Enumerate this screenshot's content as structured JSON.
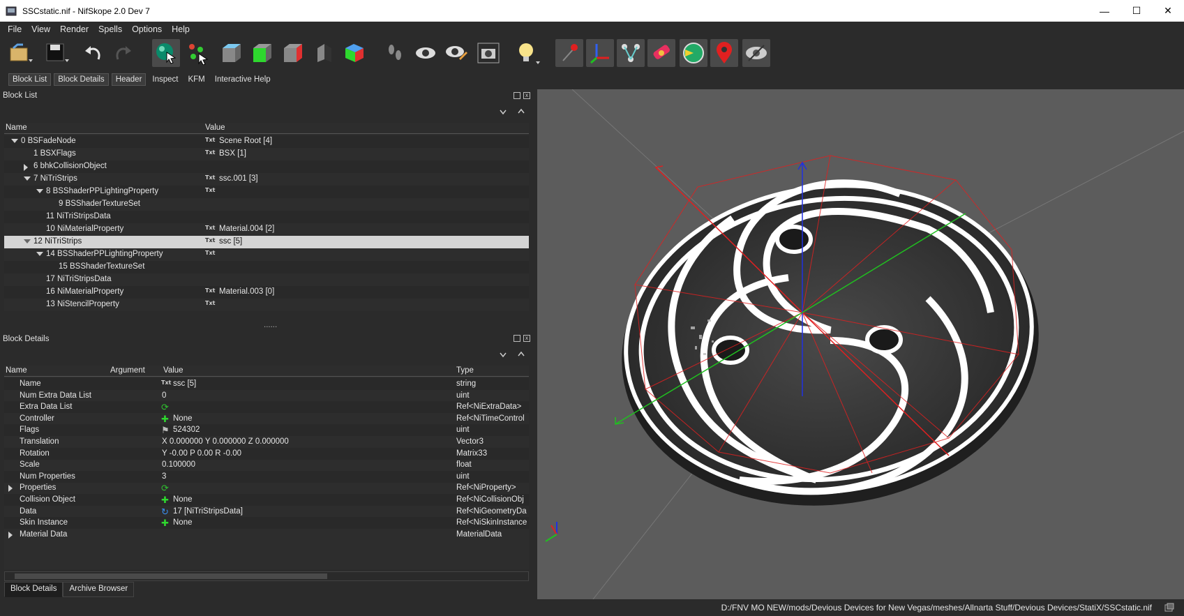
{
  "window": {
    "title": "SSCstatic.nif - NifSkope 2.0 Dev 7",
    "minimize": "—",
    "maximize": "☐",
    "close": "✕"
  },
  "menu": [
    "File",
    "View",
    "Render",
    "Spells",
    "Options",
    "Help"
  ],
  "toolbar_icons": [
    "open-icon",
    "save-icon",
    "undo-icon",
    "redo-icon",
    "select-object-icon",
    "select-vertex-icon",
    "view-top-icon",
    "view-front-icon",
    "view-side-icon",
    "view-back-icon",
    "view-user-icon",
    "walk-icon",
    "eye-icon",
    "eye-edit-icon",
    "screenshot-icon",
    "lighting-icon",
    "show-axes-icon",
    "show-nodes-icon",
    "show-constraints-icon",
    "show-havok-icon",
    "show-markers-icon",
    "show-hidden-icon"
  ],
  "tabs": {
    "items": [
      "Block List",
      "Block Details",
      "Header",
      "Inspect",
      "KFM",
      "Interactive Help"
    ],
    "active": [
      "Block List",
      "Block Details",
      "Header"
    ]
  },
  "block_list": {
    "title": "Block List",
    "headers": [
      "Name",
      "Value"
    ],
    "rows": [
      {
        "name": "0 BSFadeNode",
        "value": "Scene Root [4]",
        "indent": 0,
        "exp": "down",
        "txt": true
      },
      {
        "name": "1 BSXFlags",
        "value": "BSX [1]",
        "indent": 1,
        "exp": "",
        "txt": true
      },
      {
        "name": "6 bhkCollisionObject",
        "value": "",
        "indent": 1,
        "exp": "right",
        "txt": false
      },
      {
        "name": "7 NiTriStrips",
        "value": "ssc.001 [3]",
        "indent": 1,
        "exp": "down",
        "txt": true
      },
      {
        "name": "8 BSShaderPPLightingProperty",
        "value": "",
        "indent": 2,
        "exp": "down",
        "txt": true
      },
      {
        "name": "9 BSShaderTextureSet",
        "value": "",
        "indent": 3,
        "exp": "",
        "txt": false
      },
      {
        "name": "11 NiTriStripsData",
        "value": "",
        "indent": 2,
        "exp": "",
        "txt": false
      },
      {
        "name": "10 NiMaterialProperty",
        "value": "Material.004 [2]",
        "indent": 2,
        "exp": "",
        "txt": true
      },
      {
        "name": "12 NiTriStrips",
        "value": "ssc [5]",
        "indent": 1,
        "exp": "down",
        "txt": true,
        "selected": true
      },
      {
        "name": "14 BSShaderPPLightingProperty",
        "value": "",
        "indent": 2,
        "exp": "down",
        "txt": true
      },
      {
        "name": "15 BSShaderTextureSet",
        "value": "",
        "indent": 3,
        "exp": "",
        "txt": false
      },
      {
        "name": "17 NiTriStripsData",
        "value": "",
        "indent": 2,
        "exp": "",
        "txt": false
      },
      {
        "name": "16 NiMaterialProperty",
        "value": "Material.003 [0]",
        "indent": 2,
        "exp": "",
        "txt": true
      },
      {
        "name": "13 NiStencilProperty",
        "value": "",
        "indent": 2,
        "exp": "",
        "txt": true
      }
    ]
  },
  "splitter_grip": "......",
  "block_details": {
    "title": "Block Details",
    "headers": [
      "Name",
      "Argument",
      "Value",
      "Type"
    ],
    "rows": [
      {
        "name": "Name",
        "value": "ssc [5]",
        "type": "string",
        "icon": "txt",
        "exp": ""
      },
      {
        "name": "Num Extra Data List",
        "value": "0",
        "type": "uint",
        "icon": "",
        "exp": ""
      },
      {
        "name": "Extra Data List",
        "value": "",
        "type": "Ref<NiExtraData>",
        "icon": "refresh",
        "exp": ""
      },
      {
        "name": "Controller",
        "value": "None",
        "type": "Ref<NiTimeControl",
        "icon": "plus",
        "exp": ""
      },
      {
        "name": "Flags",
        "value": "524302",
        "type": "uint",
        "icon": "flag",
        "exp": ""
      },
      {
        "name": "Translation",
        "value": "X 0.000000 Y 0.000000 Z 0.000000",
        "type": "Vector3",
        "icon": "",
        "exp": ""
      },
      {
        "name": "Rotation",
        "value": "Y -0.00 P 0.00 R -0.00",
        "type": "Matrix33",
        "icon": "",
        "exp": ""
      },
      {
        "name": "Scale",
        "value": "0.100000",
        "type": "float",
        "icon": "",
        "exp": ""
      },
      {
        "name": "Num Properties",
        "value": "3",
        "type": "uint",
        "icon": "",
        "exp": ""
      },
      {
        "name": "Properties",
        "value": "",
        "type": "Ref<NiProperty>",
        "icon": "refresh",
        "exp": "right"
      },
      {
        "name": "Collision Object",
        "value": "None",
        "type": "Ref<NiCollisionObj",
        "icon": "plus",
        "exp": ""
      },
      {
        "name": "Data",
        "value": "17 [NiTriStripsData]",
        "type": "Ref<NiGeometryDa",
        "icon": "link",
        "exp": ""
      },
      {
        "name": "Skin Instance",
        "value": "None",
        "type": "Ref<NiSkinInstance",
        "icon": "plus",
        "exp": ""
      },
      {
        "name": "Material Data",
        "value": "",
        "type": "MaterialData",
        "icon": "",
        "exp": "right"
      }
    ]
  },
  "bottom_tabs": [
    "Block Details",
    "Archive Browser"
  ],
  "status": {
    "path": "D:/FNV MO NEW/mods/Devious Devices for New Vegas/meshes/Allnarta Stuff/Devious Devices/StatiX/SSCstatic.nif"
  },
  "colors": {
    "viewport_bg": "#5c5c5c",
    "selection": "#d4d4d4",
    "wire": "#e02020",
    "axis_x": "#e02020",
    "axis_y": "#20c020",
    "axis_z": "#2030e0"
  }
}
